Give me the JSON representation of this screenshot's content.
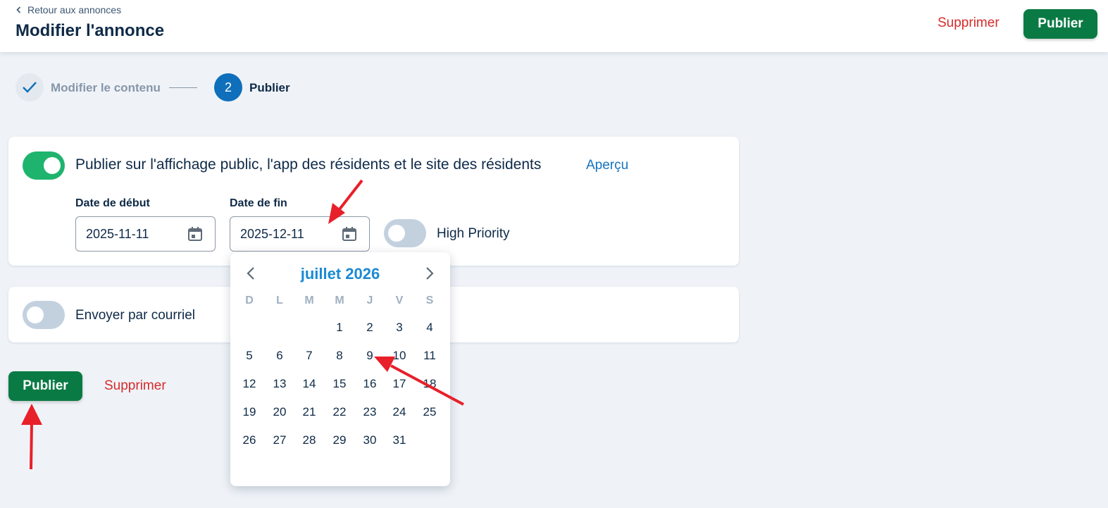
{
  "header": {
    "back_label": "Retour aux annonces",
    "title": "Modifier l'annonce",
    "delete_label": "Supprimer",
    "publish_label": "Publier"
  },
  "stepper": {
    "step1_label": "Modifier le contenu",
    "step2_number": "2",
    "step2_label": "Publier"
  },
  "publish_section": {
    "toggle_on": true,
    "label": "Publier sur l'affichage public, l'app des résidents et le site des résidents",
    "preview_label": "Aperçu",
    "start_date_label": "Date de début",
    "start_date_value": "2025-11-11",
    "end_date_label": "Date de fin",
    "end_date_value": "2025-12-11",
    "high_priority_label": "High Priority",
    "high_priority_on": false
  },
  "email_section": {
    "toggle_on": false,
    "label": "Envoyer par courriel"
  },
  "footer": {
    "publish_label": "Publier",
    "delete_label": "Supprimer"
  },
  "calendar": {
    "title": "juillet 2026",
    "weekdays": [
      "D",
      "L",
      "M",
      "M",
      "J",
      "V",
      "S"
    ],
    "weeks": [
      [
        "",
        "",
        "",
        "1",
        "2",
        "3",
        "4"
      ],
      [
        "5",
        "6",
        "7",
        "8",
        "9",
        "10",
        "11"
      ],
      [
        "12",
        "13",
        "14",
        "15",
        "16",
        "17",
        "18"
      ],
      [
        "19",
        "20",
        "21",
        "22",
        "23",
        "24",
        "25"
      ],
      [
        "26",
        "27",
        "28",
        "29",
        "30",
        "31",
        ""
      ]
    ]
  },
  "colors": {
    "primary_green": "#0a7a44",
    "toggle_green": "#1fb46e",
    "danger_red": "#d62b2b",
    "link_blue": "#1573c1",
    "step_blue": "#0f6fba",
    "annotation_red": "#e8202a"
  },
  "icons": [
    "chevron-left-icon",
    "check-icon",
    "calendar-icon",
    "chevron-right-icon",
    "annotation-arrow"
  ]
}
